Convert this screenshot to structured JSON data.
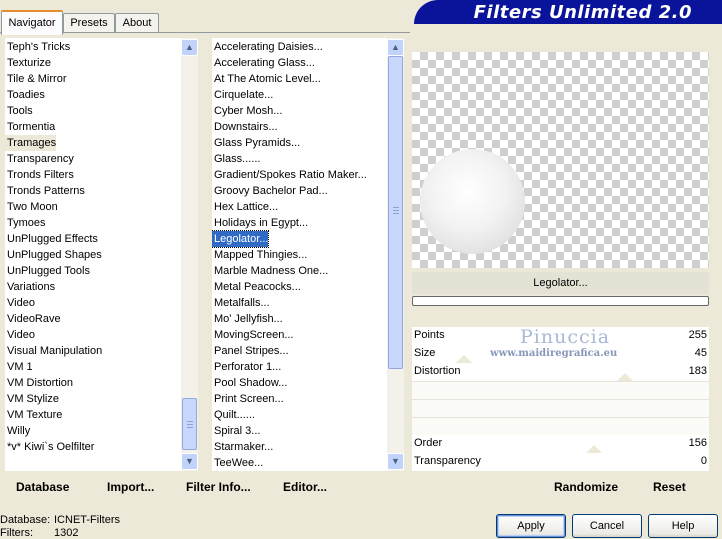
{
  "title": "Filters Unlimited 2.0",
  "tabs": [
    {
      "label": "Navigator",
      "active": true
    },
    {
      "label": "Presets",
      "active": false
    },
    {
      "label": "About",
      "active": false
    }
  ],
  "categories": [
    "Teph's Tricks",
    "Texturize",
    "Tile & Mirror",
    "Toadies",
    "Tools",
    "Tormentia",
    "Tramages",
    "Transparency",
    "Tronds Filters",
    "Tronds Patterns",
    "Two Moon",
    "Tymoes",
    "UnPlugged Effects",
    "UnPlugged Shapes",
    "UnPlugged Tools",
    "Variations",
    "Video",
    "VideoRave",
    "Video",
    "Visual Manipulation",
    "VM 1",
    "VM Distortion",
    "VM Stylize",
    "VM Texture",
    "Willy",
    "*v* Kiwi`s Oelfilter"
  ],
  "selected_category_index": 6,
  "filters": [
    "Accelerating Daisies...",
    "Accelerating Glass...",
    "At The Atomic Level...",
    "Cirquelate...",
    "Cyber Mosh...",
    "Downstairs...",
    "Glass Pyramids...",
    "Glass......",
    "Gradient/Spokes Ratio Maker...",
    "Groovy Bachelor Pad...",
    "Hex Lattice...",
    "Holidays in Egypt...",
    "Legolator...",
    "Mapped Thingies...",
    "Marble Madness One...",
    "Metal Peacocks...",
    "Metalfalls...",
    "Mo' Jellyfish...",
    "MovingScreen...",
    "Panel Stripes...",
    "Perforator 1...",
    "Pool Shadow...",
    "Print Screen...",
    "Quilt......",
    "Spiral 3...",
    "Starmaker...",
    "TeeWee..."
  ],
  "selected_filter_index": 12,
  "preview": {
    "filter_name": "Legolator..."
  },
  "params_top": [
    {
      "label": "Points",
      "value": "255"
    },
    {
      "label": "Size",
      "value": "45"
    },
    {
      "label": "Distortion",
      "value": "183"
    }
  ],
  "params_bottom": [
    {
      "label": "Order",
      "value": "156"
    },
    {
      "label": "Transparency",
      "value": "0"
    }
  ],
  "watermark": {
    "name": "Pinuccia",
    "url": "www.maidiregrafica.eu"
  },
  "actions": {
    "database": "Database",
    "import": "Import...",
    "filter_info": "Filter Info...",
    "editor": "Editor...",
    "randomize": "Randomize",
    "reset": "Reset"
  },
  "info": {
    "database_label": "Database:",
    "database_value": "ICNET-Filters",
    "filters_label": "Filters:",
    "filters_value": "1302"
  },
  "buttons": {
    "apply": "Apply",
    "cancel": "Cancel",
    "help": "Help"
  },
  "colors": {
    "banner": "#0a149a",
    "selection": "#316ac5",
    "window": "#ece9d8"
  }
}
